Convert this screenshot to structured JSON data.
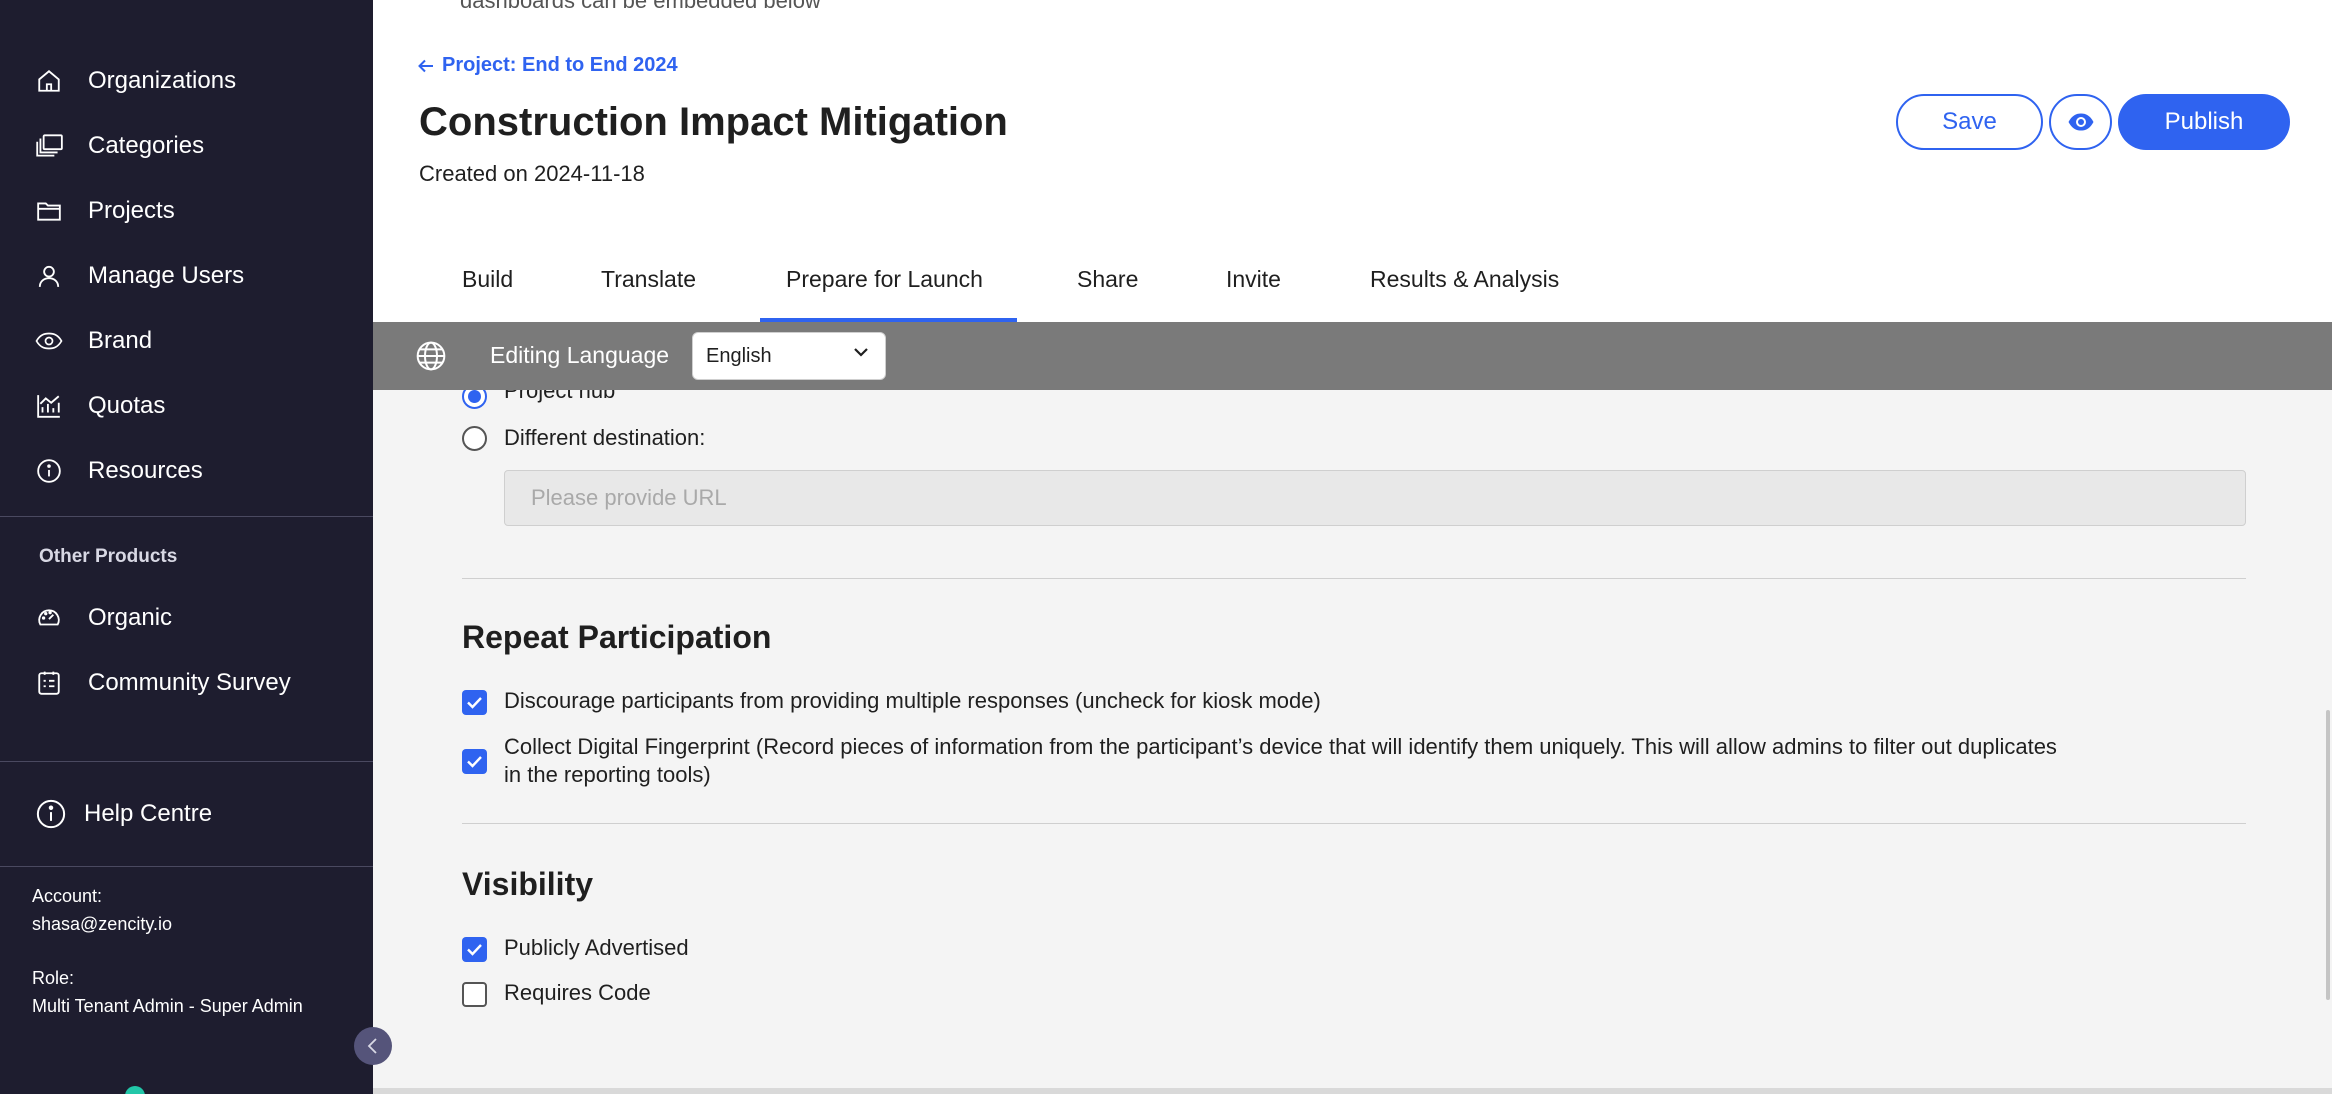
{
  "sidebar": {
    "items": [
      {
        "label": "Organizations",
        "icon": "home-icon"
      },
      {
        "label": "Categories",
        "icon": "categories-icon"
      },
      {
        "label": "Projects",
        "icon": "folder-icon"
      },
      {
        "label": "Manage Users",
        "icon": "user-icon"
      },
      {
        "label": "Brand",
        "icon": "eye-icon"
      },
      {
        "label": "Quotas",
        "icon": "chart-icon"
      },
      {
        "label": "Resources",
        "icon": "info-icon"
      }
    ],
    "other_products_title": "Other Products",
    "other_products": [
      {
        "label": "Organic",
        "icon": "gauge-icon"
      },
      {
        "label": "Community Survey",
        "icon": "survey-icon"
      }
    ],
    "help": {
      "label": "Help Centre",
      "icon": "info-circle-icon"
    },
    "account": {
      "account_label": "Account:",
      "account_value": "shasa@zencity.io",
      "role_label": "Role:",
      "role_value": "Multi Tenant Admin - Super Admin"
    }
  },
  "header": {
    "cut_text": "dashboards can be embedded below",
    "back_link": "Project: End to End 2024",
    "title": "Construction Impact Mitigation",
    "created": "Created on 2024-11-18",
    "save_label": "Save",
    "publish_label": "Publish",
    "tabs": [
      "Build",
      "Translate",
      "Prepare for Launch",
      "Share",
      "Invite",
      "Results & Analysis"
    ],
    "active_tab": "Prepare for Launch"
  },
  "language_bar": {
    "label": "Editing Language",
    "selected": "English"
  },
  "content": {
    "redirect": {
      "option_project_hub": "Project hub",
      "option_different": "Different destination:",
      "url_placeholder": "Please provide URL"
    },
    "repeat_participation": {
      "title": "Repeat Participation",
      "discourage": "Discourage participants from providing multiple responses (uncheck for kiosk mode)",
      "fingerprint_line1": "Collect Digital Fingerprint (Record pieces of information from the participant’s device that will identify them uniquely. This will allow admins to filter out duplicates",
      "fingerprint_line2": "in the reporting tools)"
    },
    "visibility": {
      "title": "Visibility",
      "publicly_advertised": "Publicly Advertised",
      "requires_code": "Requires Code"
    }
  },
  "colors": {
    "accent": "#2f63f0",
    "sidebar_bg": "#1e1d2f",
    "language_bar_bg": "#7a7a7a",
    "content_bg": "#f4f4f4"
  }
}
